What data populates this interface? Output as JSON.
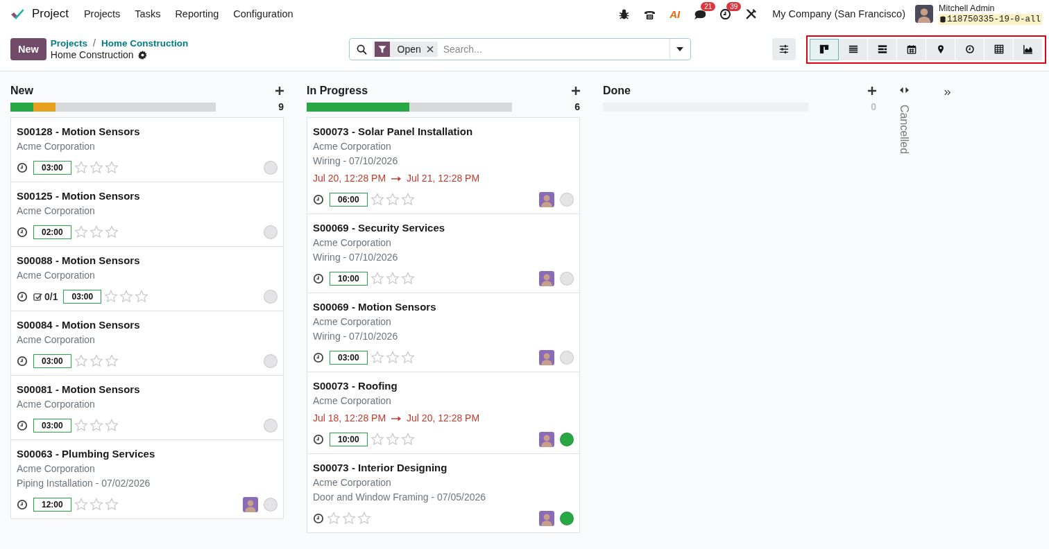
{
  "navbar": {
    "app_name": "Project",
    "menu": [
      "Projects",
      "Tasks",
      "Reporting",
      "Configuration"
    ],
    "systray": [
      {
        "kind": "bug"
      },
      {
        "kind": "phone"
      },
      {
        "kind": "ai",
        "label": "AI"
      },
      {
        "kind": "chat",
        "badge": "21"
      },
      {
        "kind": "clock",
        "badge": "39"
      },
      {
        "kind": "tools"
      }
    ],
    "company": "My Company (San Francisco)",
    "user": {
      "name": "Mitchell Admin",
      "database": "118750335-19-0-all"
    }
  },
  "control_panel": {
    "new_button": "New",
    "breadcrumbs": [
      "Projects",
      "Home Construction"
    ],
    "breadcrumb_separator": "/",
    "current": "Home Construction",
    "search": {
      "facet": "Open",
      "placeholder": "Search..."
    },
    "views_highlighted": true,
    "views": [
      {
        "kind": "kanban",
        "selected": true
      },
      {
        "kind": "list",
        "selected": false
      },
      {
        "kind": "gantt",
        "selected": false
      },
      {
        "kind": "calendar",
        "selected": false
      },
      {
        "kind": "map",
        "selected": false
      },
      {
        "kind": "activity",
        "selected": false
      },
      {
        "kind": "pivot",
        "selected": false
      },
      {
        "kind": "graph",
        "selected": false
      }
    ]
  },
  "columns": [
    {
      "name": "New",
      "count": "9",
      "progress": [
        {
          "color": "#28a745",
          "level": 0.11
        },
        {
          "color": "#e8a020",
          "level": 0.11
        }
      ],
      "cards": [
        {
          "title": "S00128 - Motion Sensors",
          "customer": "Acme Corporation",
          "hours": "03:00",
          "stars": 0,
          "status": {
            "color": "#e4e4e6"
          }
        },
        {
          "title": "S00125 - Motion Sensors",
          "customer": "Acme Corporation",
          "hours": "02:00",
          "stars": 0,
          "status": {
            "color": "#e4e4e6"
          }
        },
        {
          "title": "S00088 - Motion Sensors",
          "customer": "Acme Corporation",
          "checklist": "0/1",
          "hours": "03:00",
          "stars": 0,
          "status": {
            "color": "#e4e4e6"
          }
        },
        {
          "title": "S00084 - Motion Sensors",
          "customer": "Acme Corporation",
          "hours": "03:00",
          "stars": 0,
          "status": {
            "color": "#e4e4e6"
          }
        },
        {
          "title": "S00081 - Motion Sensors",
          "customer": "Acme Corporation",
          "hours": "03:00",
          "stars": 0,
          "status": {
            "color": "#e4e4e6"
          }
        },
        {
          "title": "S00063 - Plumbing Services",
          "customer": "Acme Corporation",
          "subtitle": "Piping Installation - 07/02/2026",
          "hours": "12:00",
          "stars": 0,
          "status": {
            "color": "#e4e4e6"
          }
        }
      ]
    },
    {
      "name": "In Progress",
      "count": "6",
      "progress": [
        {
          "color": "#28a745",
          "level": 0.5
        }
      ],
      "cards": [
        {
          "title": "S00073 - Solar Panel Installation",
          "customer": "Acme Corporation",
          "subtitle": "Wiring - 07/10/2026",
          "dates": {
            "start": "Jul 20, 12:28 PM",
            "end": "Jul 21, 12:28 PM"
          },
          "hours": "06:00",
          "stars": 0,
          "status": {
            "color": "#e4e4e6"
          }
        },
        {
          "title": "S00069 - Security Services",
          "customer": "Acme Corporation",
          "subtitle": "Wiring - 07/10/2026",
          "hours": "10:00",
          "stars": 0,
          "status": {
            "color": "#e4e4e6"
          }
        },
        {
          "title": "S00069 - Motion Sensors",
          "customer": "Acme Corporation",
          "subtitle": "Wiring - 07/10/2026",
          "hours": "03:00",
          "stars": 0,
          "status": {
            "color": "#e4e4e6"
          }
        },
        {
          "title": "S00073 - Roofing",
          "customer": "Acme Corporation",
          "dates": {
            "start": "Jul 18, 12:28 PM",
            "end": "Jul 20, 12:28 PM"
          },
          "hours": "10:00",
          "stars": 0,
          "status": {
            "color": "#28a745"
          }
        },
        {
          "title": "S00073 - Interior Designing",
          "customer": "Acme Corporation",
          "subtitle": "Door and Window Framing - 07/05/2026",
          "stars": 0,
          "status": {
            "color": "#28a745"
          }
        }
      ]
    },
    {
      "name": "Done",
      "count": "0"
    }
  ],
  "folded_columns": [
    {
      "name": "Cancelled"
    }
  ]
}
